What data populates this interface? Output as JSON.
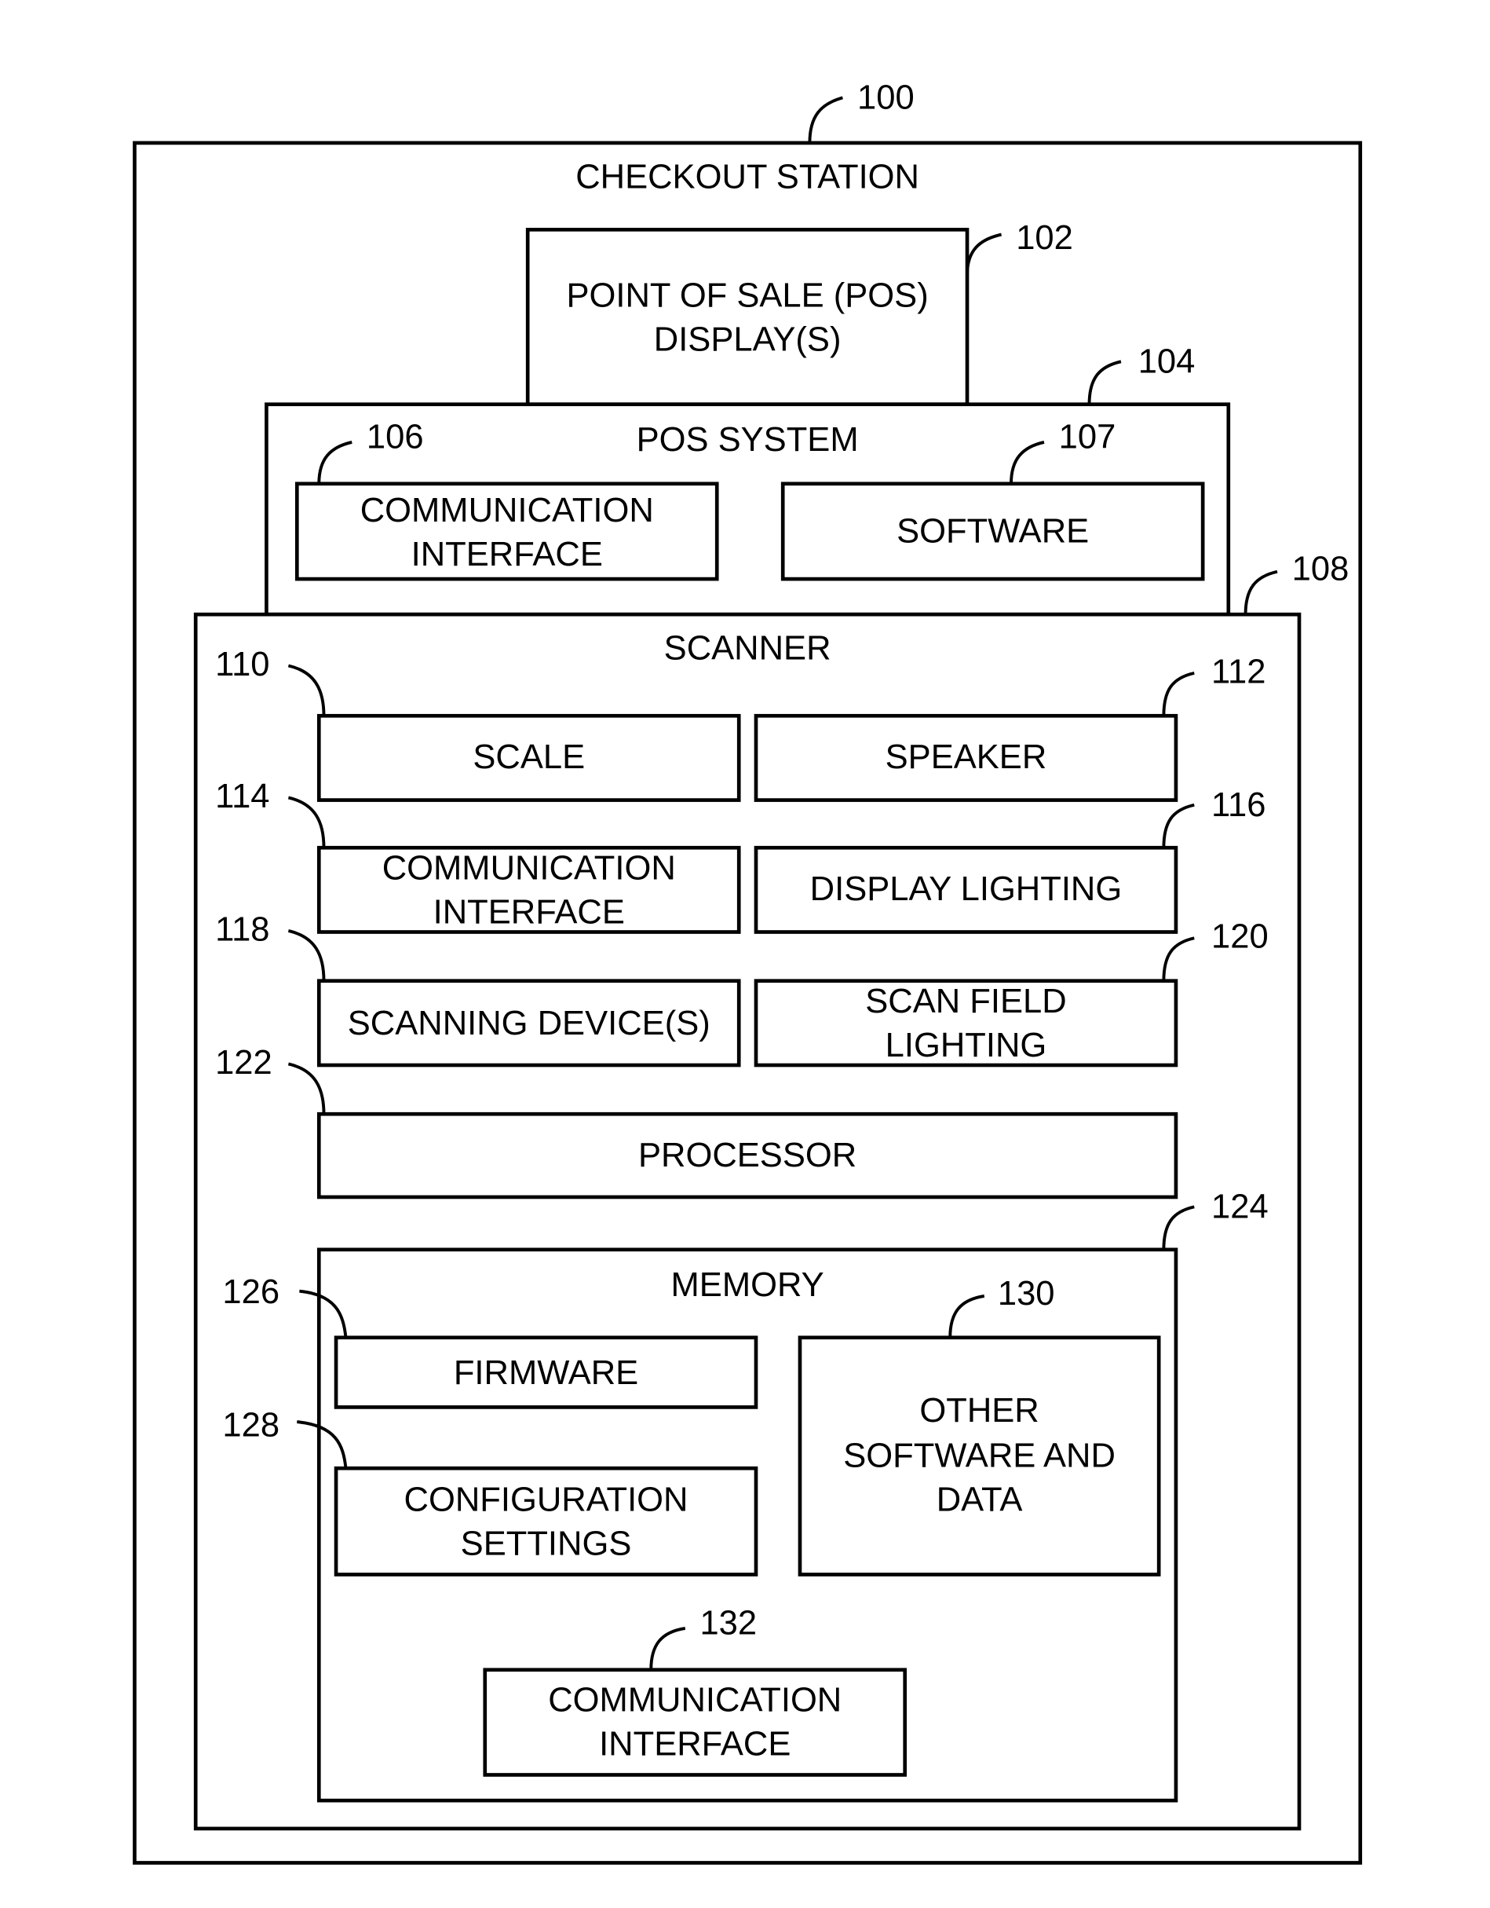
{
  "figure": {
    "checkout_station": {
      "ref": "100",
      "title": "CHECKOUT STATION"
    },
    "pos_display": {
      "ref": "102",
      "lines": [
        "POINT OF SALE (POS)",
        "DISPLAY(S)"
      ]
    },
    "pos_system": {
      "ref": "104",
      "title": "POS SYSTEM",
      "communication_interface": {
        "ref": "106",
        "lines": [
          "COMMUNICATION",
          "INTERFACE"
        ]
      },
      "software": {
        "ref": "107",
        "lines": [
          "SOFTWARE"
        ]
      }
    },
    "scanner": {
      "ref": "108",
      "title": "SCANNER",
      "scale": {
        "ref": "110",
        "lines": [
          "SCALE"
        ]
      },
      "speaker": {
        "ref": "112",
        "lines": [
          "SPEAKER"
        ]
      },
      "communication_interface": {
        "ref": "114",
        "lines": [
          "COMMUNICATION",
          "INTERFACE"
        ]
      },
      "display_lighting": {
        "ref": "116",
        "lines": [
          "DISPLAY LIGHTING"
        ]
      },
      "scanning_devices": {
        "ref": "118",
        "lines": [
          "SCANNING DEVICE(S)"
        ]
      },
      "scan_field_lighting": {
        "ref": "120",
        "lines": [
          "SCAN FIELD",
          "LIGHTING"
        ]
      },
      "processor": {
        "ref": "122",
        "lines": [
          "PROCESSOR"
        ]
      },
      "memory": {
        "ref": "124",
        "title": "MEMORY",
        "firmware": {
          "ref": "126",
          "lines": [
            "FIRMWARE"
          ]
        },
        "configuration_settings": {
          "ref": "128",
          "lines": [
            "CONFIGURATION",
            "SETTINGS"
          ]
        },
        "other_software_and_data": {
          "ref": "130",
          "lines": [
            "OTHER",
            "SOFTWARE AND",
            "DATA"
          ]
        },
        "communication_interface": {
          "ref": "132",
          "lines": [
            "COMMUNICATION",
            "INTERFACE"
          ]
        }
      }
    }
  }
}
